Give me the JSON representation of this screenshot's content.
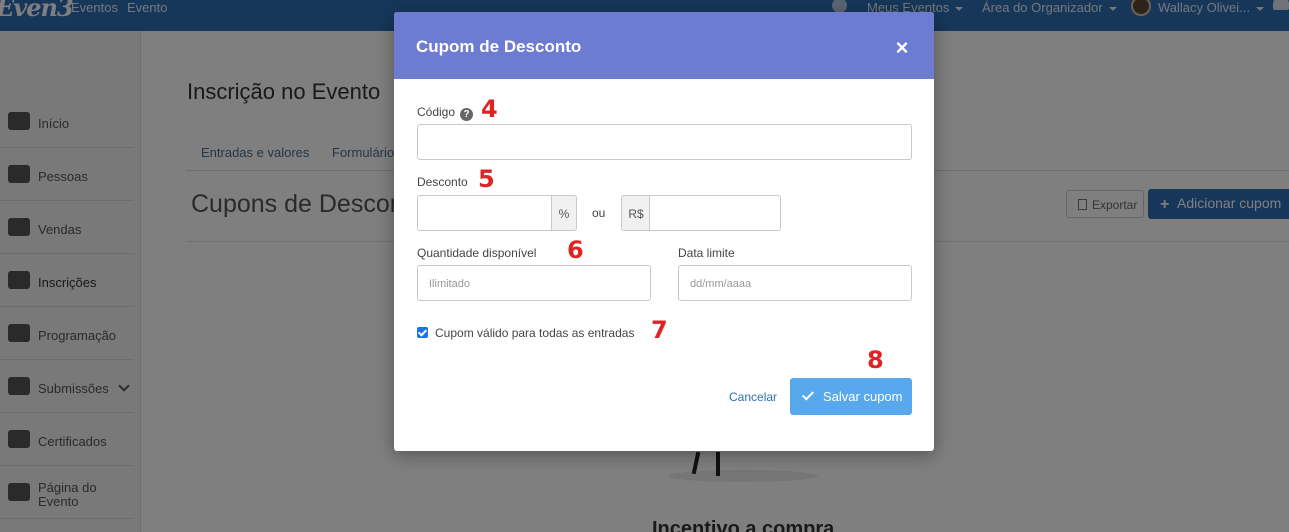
{
  "topbar": {
    "logo": "Even3",
    "nav": [
      "Eventos",
      "Evento"
    ],
    "meus_eventos": "Meus Eventos",
    "area_organizador": "Área do Organizador",
    "user_name": "Wallacy Olivei..."
  },
  "sidebar": {
    "items": [
      {
        "label": "Início"
      },
      {
        "label": "Pessoas"
      },
      {
        "label": "Vendas"
      },
      {
        "label": "Inscrições"
      },
      {
        "label": "Programação"
      },
      {
        "label": "Submissões"
      },
      {
        "label": "Certificados"
      },
      {
        "label": "Página do Evento"
      }
    ]
  },
  "main": {
    "title": "Inscrição no Evento",
    "tabs": [
      "Entradas e valores",
      "Formulário"
    ],
    "section_title": "Cupons de Desconto",
    "export_label": "Exportar",
    "add_label": "Adicionar cupom",
    "incentivo": "Incentivo a compra"
  },
  "modal": {
    "title": "Cupom de Desconto",
    "close": "×",
    "codigo_label": "Código",
    "help_glyph": "?",
    "codigo_value": "",
    "desconto_label": "Desconto",
    "percent_addon": "%",
    "ou": "ou",
    "currency_addon": "R$",
    "quantidade_label": "Quantidade disponível",
    "quantidade_placeholder": "Ilimitado",
    "data_label": "Data limite",
    "data_placeholder": "dd/mm/aaaa",
    "checkbox_label": "Cupom válido para todas as entradas",
    "checkbox_checked": true,
    "cancel_label": "Cancelar",
    "save_label": "Salvar cupom"
  },
  "annotations": [
    "4",
    "5",
    "6",
    "7",
    "8"
  ],
  "colors": {
    "navbar": "#2d6fb5",
    "modal_header": "#6d7bd0",
    "save_button": "#58a8ee",
    "annotation": "#e02424"
  }
}
